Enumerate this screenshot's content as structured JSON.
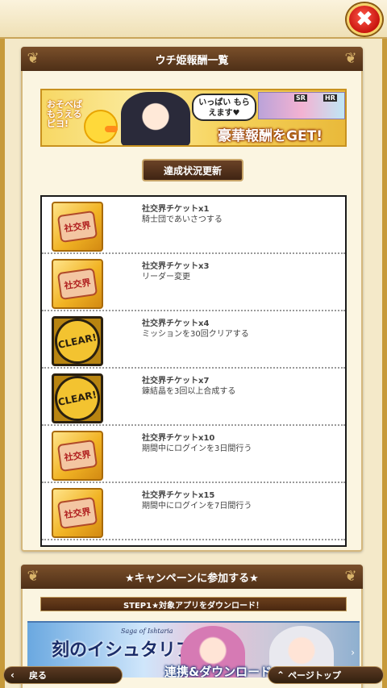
{
  "header": {
    "close_label": "✖"
  },
  "rewards_panel": {
    "title": "ウチ姫報酬一覧",
    "banner": {
      "bubble_left": "おそべば もうえる ピヨ!",
      "bubble_right": "いっぱい もらえます♥",
      "card_badge_1": "SR",
      "card_badge_2": "HR",
      "headline": "豪華報酬をGET!"
    },
    "update_button": "達成状況更新",
    "items": [
      {
        "title": "社交界チケットx1",
        "description": "騎士団であいさつする",
        "status": "ticket",
        "icon_label": "社交界"
      },
      {
        "title": "社交界チケットx3",
        "description": "リーダー変更",
        "status": "ticket",
        "icon_label": "社交界"
      },
      {
        "title": "社交界チケットx4",
        "description": "ミッションを30回クリアする",
        "status": "clear",
        "icon_label": "CLEAR!"
      },
      {
        "title": "社交界チケットx7",
        "description": "錬結晶を3回以上合成する",
        "status": "clear",
        "icon_label": "CLEAR!"
      },
      {
        "title": "社交界チケットx10",
        "description": "期間中にログインを3日間行う",
        "status": "ticket",
        "icon_label": "社交界"
      },
      {
        "title": "社交界チケットx15",
        "description": "期間中にログインを7日間行う",
        "status": "ticket",
        "icon_label": "社交界"
      }
    ]
  },
  "campaign_panel": {
    "title": "★キャンペーンに参加する★",
    "step1": "STEP1★対象アプリをダウンロード！",
    "app_banner": {
      "logo": "刻のイシュタリア",
      "saga": "Saga of Ishtaria",
      "label": "連携&ダウンロード"
    }
  },
  "footer": {
    "back_label": "戻る",
    "page_top_label": "ページトップ"
  },
  "colors": {
    "panel_header": "#5a3820",
    "gold": "#f1b324",
    "close_red": "#d8201a"
  }
}
